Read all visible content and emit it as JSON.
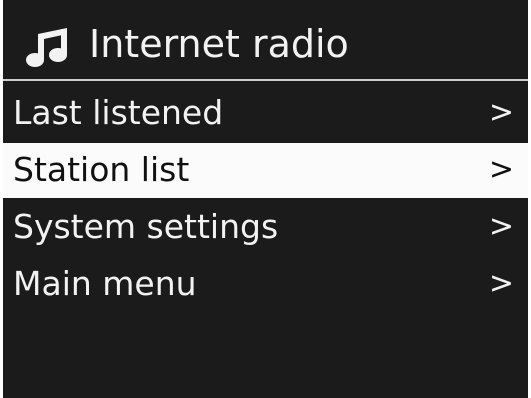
{
  "header": {
    "icon": "music-note-icon",
    "title": "Internet radio"
  },
  "menu": {
    "items": [
      {
        "label": "Last listened",
        "chevron": ">",
        "selected": false
      },
      {
        "label": "Station list",
        "chevron": ">",
        "selected": true
      },
      {
        "label": "System settings",
        "chevron": ">",
        "selected": false
      },
      {
        "label": "Main menu",
        "chevron": ">",
        "selected": false
      }
    ]
  },
  "colors": {
    "background": "#1c1b1c",
    "text": "#f2f2f2",
    "highlight_background": "#fbfbfb",
    "highlight_text": "#111111"
  }
}
